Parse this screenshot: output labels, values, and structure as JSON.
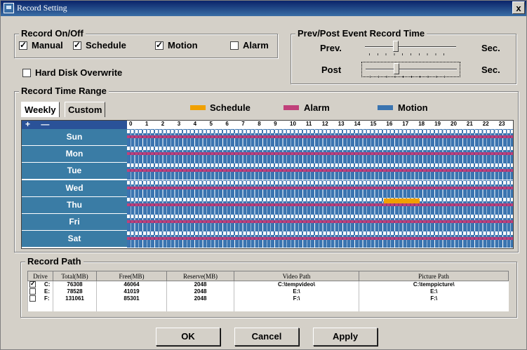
{
  "window": {
    "title": "Record Setting",
    "close_glyph": "x"
  },
  "record_onoff": {
    "label": "Record On/Off",
    "manual": {
      "label": "Manual",
      "checked": true
    },
    "schedule": {
      "label": "Schedule",
      "checked": true
    },
    "motion": {
      "label": "Motion",
      "checked": true
    },
    "alarm": {
      "label": "Alarm",
      "checked": false
    }
  },
  "hard_disk_overwrite": {
    "label": "Hard Disk Overwrite",
    "checked": false
  },
  "prepost": {
    "label": "Prev/Post Event Record Time",
    "prev_label": "Prev.",
    "post_label": "Post",
    "unit": "Sec."
  },
  "time_range": {
    "label": "Record Time Range",
    "tabs": [
      "Weekly",
      "Custom"
    ],
    "legend": [
      {
        "label": "Schedule",
        "color": "#f0a000"
      },
      {
        "label": "Alarm",
        "color": "#c0407a"
      },
      {
        "label": "Motion",
        "color": "#3a74b0"
      }
    ],
    "zoom_label": "+ —",
    "hours": [
      "0",
      "1",
      "2",
      "3",
      "4",
      "5",
      "6",
      "7",
      "8",
      "9",
      "10",
      "11",
      "12",
      "13",
      "14",
      "15",
      "16",
      "17",
      "18",
      "19",
      "20",
      "21",
      "22",
      "23"
    ],
    "days": [
      "Sun",
      "Mon",
      "Tue",
      "Wed",
      "Thu",
      "Fri",
      "Sat"
    ]
  },
  "record_path": {
    "label": "Record Path",
    "columns": [
      "Drive",
      "Total(MB)",
      "Free(MB)",
      "Reserve(MB)",
      "Video Path",
      "Picture Path"
    ],
    "rows": [
      {
        "checked": true,
        "drive": "C:",
        "total": "76308",
        "free": "46064",
        "reserve": "2048",
        "video": "C:\\tempvideo\\",
        "picture": "C:\\temppicture\\"
      },
      {
        "checked": false,
        "drive": "E:",
        "total": "78528",
        "free": "41019",
        "reserve": "2048",
        "video": "E:\\",
        "picture": "E:\\"
      },
      {
        "checked": false,
        "drive": "F:",
        "total": "131061",
        "free": "85301",
        "reserve": "2048",
        "video": "F:\\",
        "picture": "F:\\"
      }
    ]
  },
  "buttons": {
    "ok": "OK",
    "cancel": "Cancel",
    "apply": "Apply"
  }
}
